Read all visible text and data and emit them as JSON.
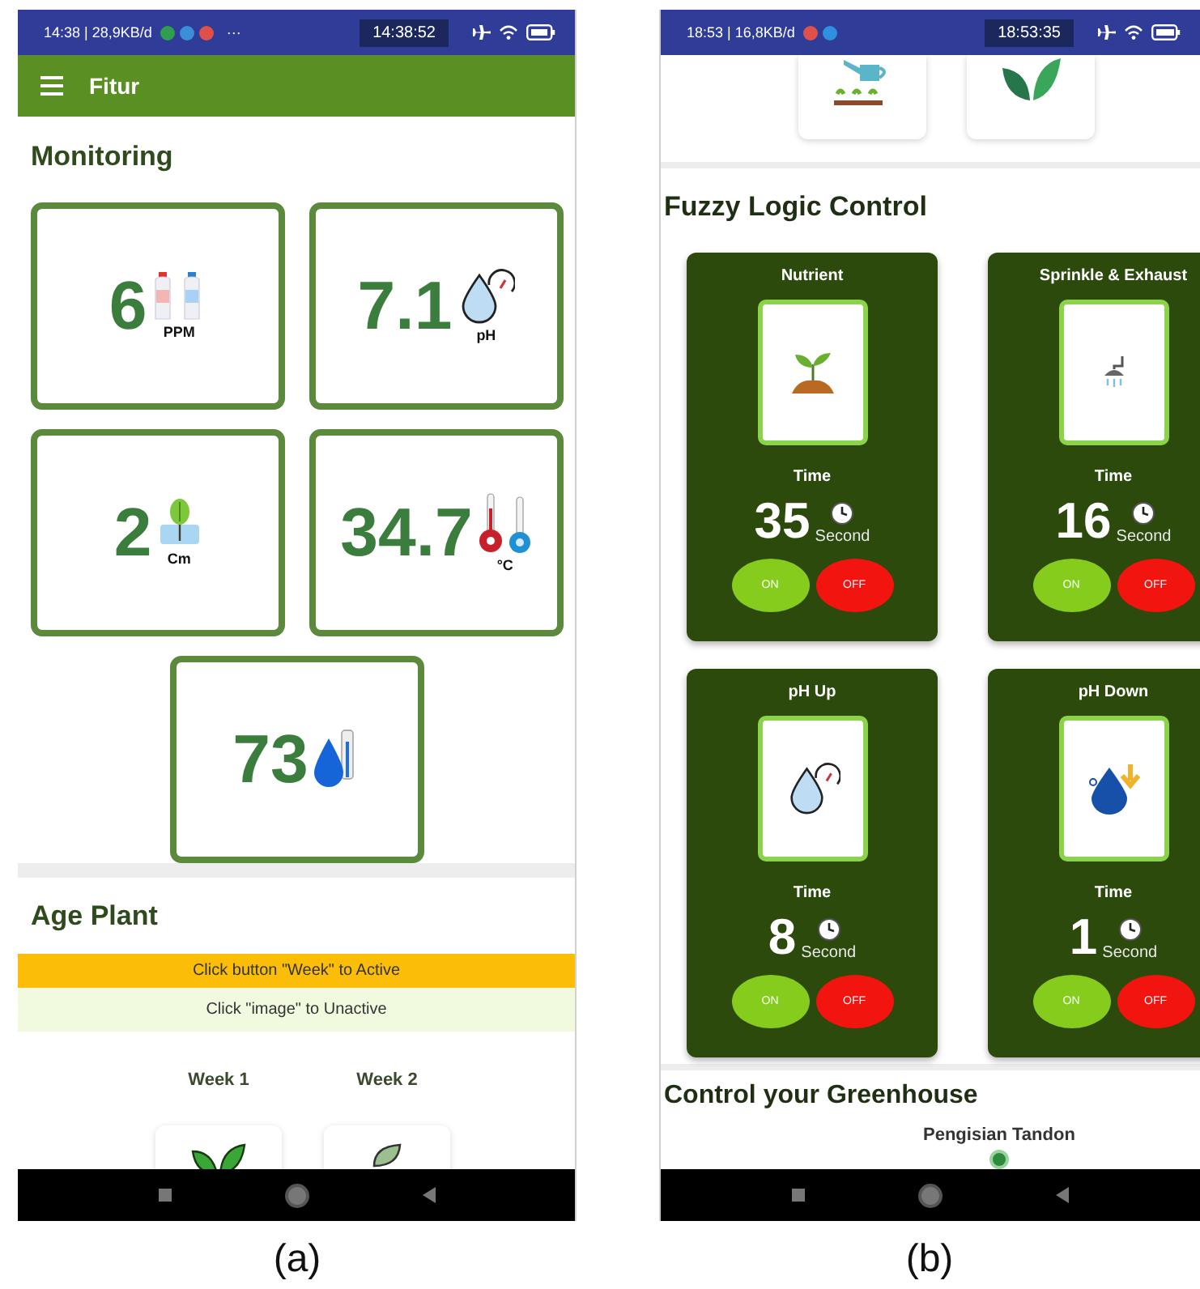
{
  "figure_a": {
    "caption": "(a)",
    "status_bar": {
      "left": "14:38 | 28,9KB/d",
      "notification_icons": [
        {
          "color": "#2f9e4f"
        },
        {
          "color": "#3a8fd8"
        },
        {
          "color": "#e0504a"
        }
      ],
      "more": "···",
      "clock": "14:38:52"
    },
    "app_bar": {
      "title": "Fitur"
    },
    "monitoring": {
      "title": "Monitoring",
      "cards": [
        {
          "value": "6",
          "unit": "PPM",
          "kind": "nutrient"
        },
        {
          "value": "7.1",
          "unit": "pH",
          "kind": "ph"
        },
        {
          "value": "2",
          "unit": "Cm",
          "kind": "height"
        },
        {
          "value": "34.7",
          "unit": "°C",
          "kind": "temperature"
        },
        {
          "value": "73",
          "kind": "humidity"
        }
      ]
    },
    "age_plant": {
      "title": "Age Plant",
      "hints": [
        {
          "text": "Click button \"Week\" to Active",
          "kind": "active"
        },
        {
          "text": "Click \"image\" to Unactive",
          "kind": "inactive"
        }
      ],
      "weeks": [
        {
          "label": "Week 1",
          "kind": "sprouts"
        },
        {
          "label": "Week 2",
          "kind": "leaf"
        }
      ]
    }
  },
  "figure_b": {
    "caption": "(b)",
    "status_bar": {
      "left": "18:53 | 16,8KB/d",
      "notification_icons": [
        {
          "color": "#e0504a"
        },
        {
          "color": "#2f8fe0"
        }
      ],
      "clock": "18:53:35"
    },
    "tiles": [
      {
        "kind": "watering"
      },
      {
        "kind": "leaves"
      }
    ],
    "fuzzy": {
      "title": "Fuzzy Logic Control",
      "controls": [
        {
          "name": "Nutrient",
          "kind": "nutrient",
          "time_label": "Time",
          "value": "35",
          "unit": "Second",
          "on_label": "ON",
          "off_label": "OFF"
        },
        {
          "name": "Sprinkle & Exhaust",
          "kind": "sprinkle",
          "time_label": "Time",
          "value": "16",
          "unit": "Second",
          "on_label": "ON",
          "off_label": "OFF"
        },
        {
          "name": "pH Up",
          "kind": "ph_up",
          "time_label": "Time",
          "value": "8",
          "unit": "Second",
          "on_label": "ON",
          "off_label": "OFF"
        },
        {
          "name": "pH Down",
          "kind": "ph_down",
          "time_label": "Time",
          "value": "1",
          "unit": "Second",
          "on_label": "ON",
          "off_label": "OFF"
        }
      ]
    },
    "greenhouse": {
      "title": "Control your Greenhouse",
      "items": [
        {
          "label": "Pengisian Tandon"
        }
      ]
    }
  }
}
